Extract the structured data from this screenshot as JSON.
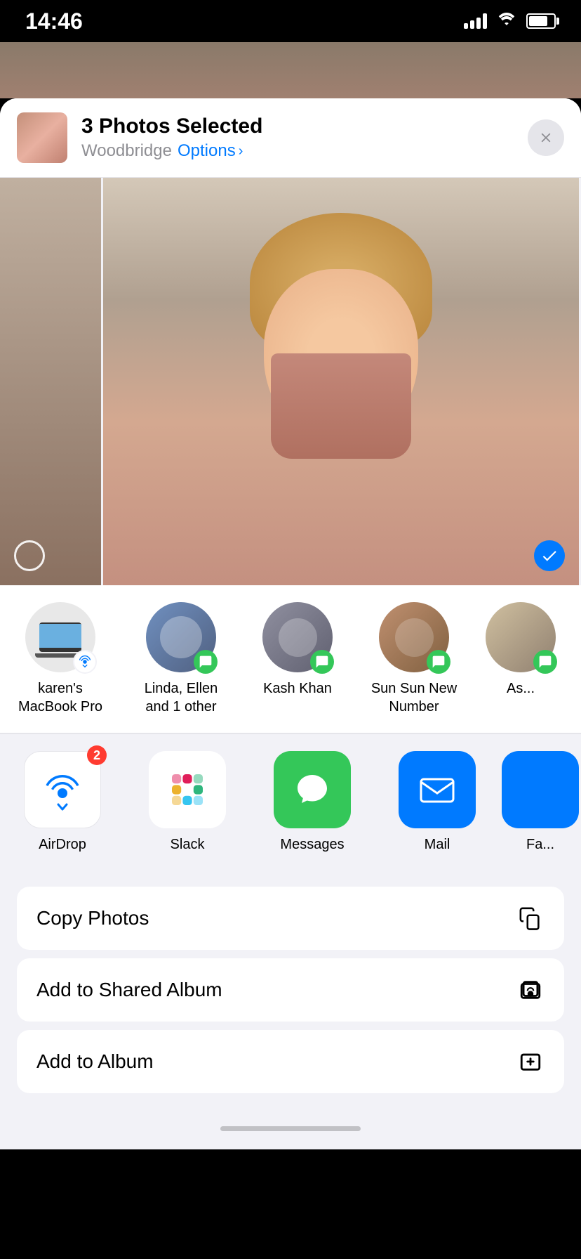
{
  "status": {
    "time": "14:46"
  },
  "share_header": {
    "title": "3 Photos Selected",
    "subtitle": "Woodbridge",
    "options_label": "Options",
    "close_label": "×"
  },
  "people": [
    {
      "name": "karen's MacBook Pro",
      "type": "airdrop",
      "avatar_type": "macbook"
    },
    {
      "name": "Linda, Ellen and 1 other",
      "type": "messages",
      "avatar_type": "photo",
      "color": "#6080a0"
    },
    {
      "name": "Kash Khan",
      "type": "messages",
      "avatar_type": "photo",
      "color": "#8090a0"
    },
    {
      "name": "Sun Sun New Number",
      "type": "messages",
      "avatar_type": "photo",
      "color": "#c09070"
    },
    {
      "name": "As...",
      "type": "messages",
      "avatar_type": "photo",
      "color": "#d0c0b0"
    }
  ],
  "apps": [
    {
      "label": "AirDrop",
      "type": "airdrop",
      "badge": "2"
    },
    {
      "label": "Slack",
      "type": "slack",
      "badge": null
    },
    {
      "label": "Messages",
      "type": "messages",
      "badge": null
    },
    {
      "label": "Mail",
      "type": "mail",
      "badge": null
    },
    {
      "label": "Fa...",
      "type": "more",
      "badge": null
    }
  ],
  "actions": [
    {
      "label": "Copy Photos",
      "icon": "copy"
    },
    {
      "label": "Add to Shared Album",
      "icon": "shared-album"
    },
    {
      "label": "Add to Album",
      "icon": "add-album"
    }
  ]
}
